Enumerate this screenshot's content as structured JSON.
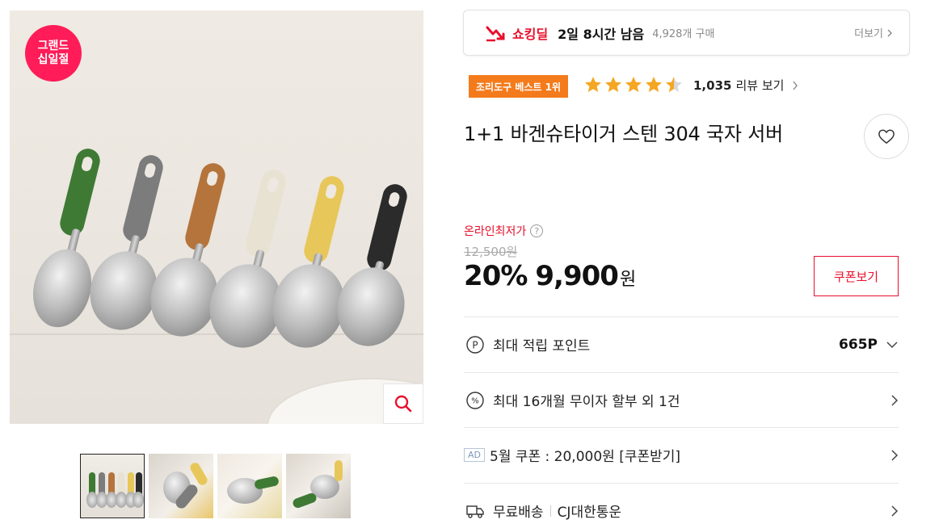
{
  "image": {
    "badge_line1": "그랜드",
    "badge_line2": "십일절",
    "zoom_icon": "search-icon",
    "thumbnails": [
      "thumb-1",
      "thumb-2",
      "thumb-3",
      "thumb-4"
    ]
  },
  "deal": {
    "title": "쇼킹딜",
    "time_left": "2일 8시간 남음",
    "purchase_count": "4,928개 구매",
    "more_label": "더보기"
  },
  "rating": {
    "best_badge": "조리도구 베스트 1위",
    "stars": 4.5,
    "review_count": "1,035",
    "review_label": "리뷰 보기"
  },
  "product": {
    "title": "1+1 바겐슈타이거 스텐 304 국자 서버"
  },
  "price": {
    "lowest_label": "온라인최저가",
    "help": "?",
    "original": "12,500원",
    "discount": "20%",
    "current": "9,900",
    "currency": "원",
    "coupon_button": "쿠폰보기"
  },
  "rows": {
    "points_label": "최대 적립 포인트",
    "points_value": "665P",
    "installment_label": "최대 16개월 무이자 할부 외 1건",
    "ad_tag": "AD",
    "coupon_label": "5월 쿠폰 : 20,000원 [쿠폰받기]",
    "shipping_label": "무료배송",
    "carrier": "CJ대한통운"
  },
  "colors": {
    "accent_red": "#e8102c",
    "best_orange": "#f47b1c",
    "star_orange": "#f5a623",
    "badge_pink": "#ff1c58"
  }
}
